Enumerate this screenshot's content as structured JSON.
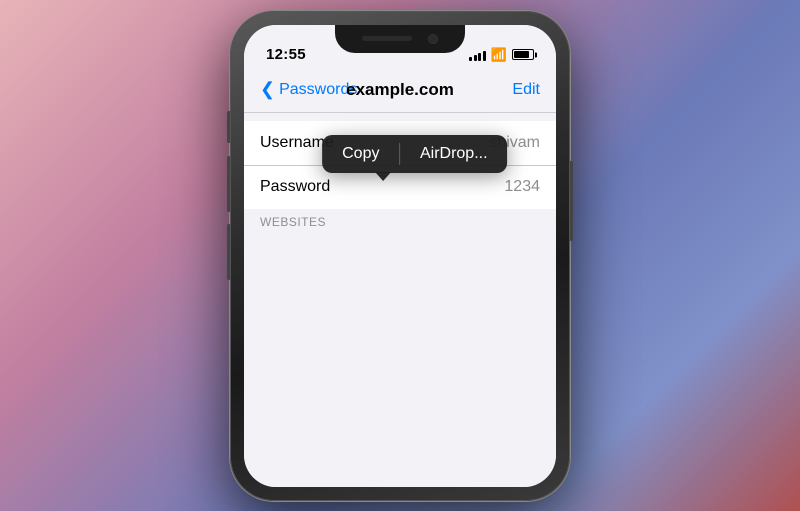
{
  "background": {
    "gradient": "linear-gradient(135deg, #e8b4b8, #c17fa0, #6b7ab8, #b05050)"
  },
  "status_bar": {
    "time": "12:55",
    "signal_bars": [
      4,
      6,
      8,
      10,
      12
    ],
    "icons": [
      "signal",
      "wifi",
      "battery"
    ]
  },
  "nav": {
    "back_label": "Passwords",
    "title": "example.com",
    "edit_label": "Edit"
  },
  "context_menu": {
    "copy_label": "Copy",
    "airdrop_label": "AirDrop..."
  },
  "rows": [
    {
      "label": "Username",
      "value": "shivam"
    },
    {
      "label": "Password",
      "value": "1234"
    }
  ],
  "section": {
    "header": "WEBSITES"
  }
}
